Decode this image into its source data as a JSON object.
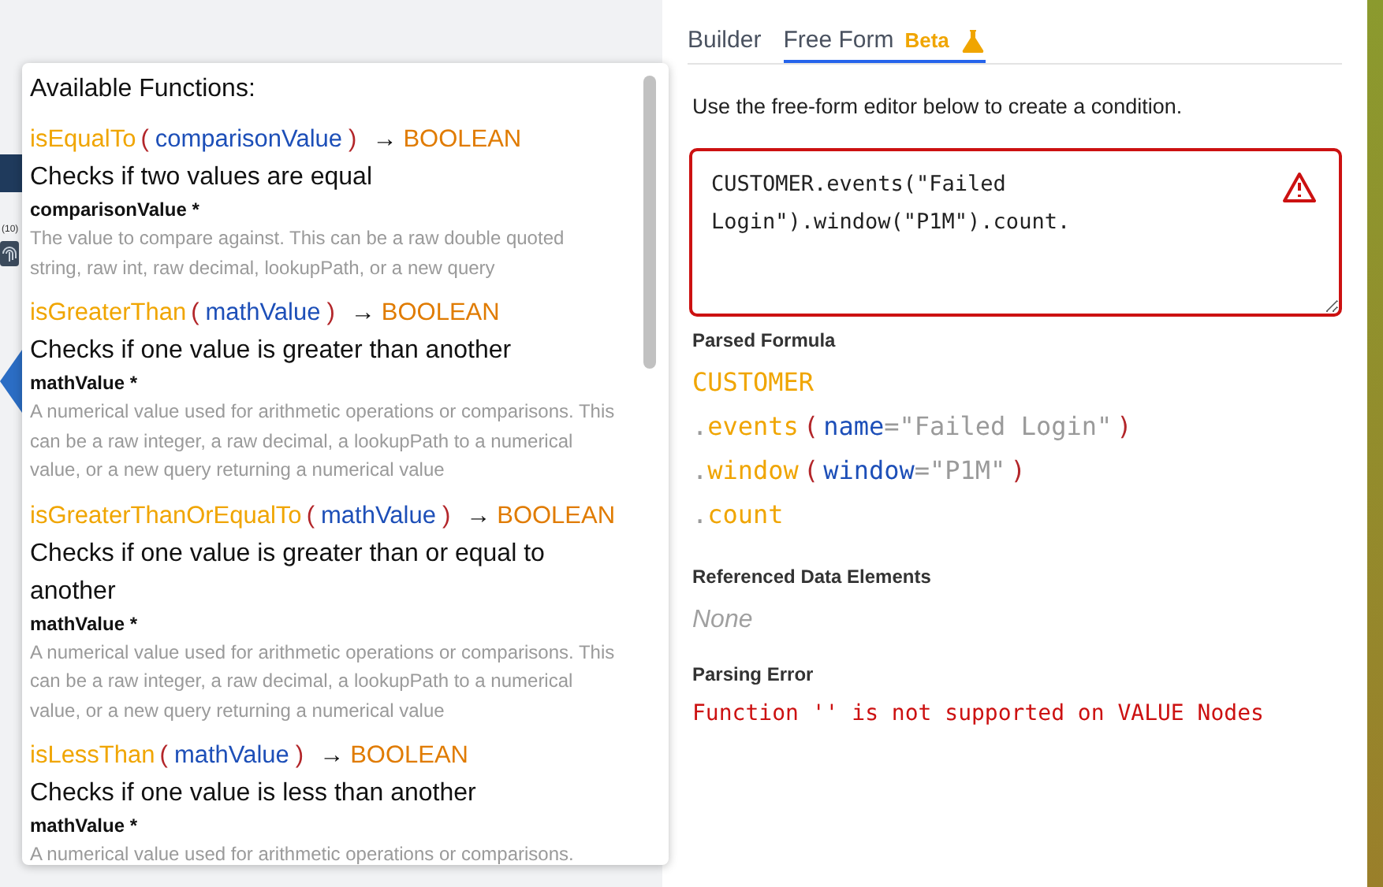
{
  "background": {
    "count_label": "(10)"
  },
  "tabs": [
    {
      "label": "Builder",
      "selected": false
    },
    {
      "label": "Free Form",
      "badge": "Beta",
      "selected": true
    }
  ],
  "functions_popup": {
    "title": "Available Functions:",
    "functions": [
      {
        "name": "isEqualTo",
        "open": "(",
        "param": "comparisonValue",
        "close": ")",
        "arrow": "→",
        "returns": "BOOLEAN",
        "description": "Checks if two values are equal",
        "param_label": "comparisonValue *",
        "param_description": "The value to compare against. This can be a raw double quoted string, raw int, raw decimal, lookupPath, or a new query"
      },
      {
        "name": "isGreaterThan",
        "open": "(",
        "param": "mathValue",
        "close": ")",
        "arrow": "→",
        "returns": "BOOLEAN",
        "description": "Checks if one value is greater than another",
        "param_label": "mathValue *",
        "param_description": "A numerical value used for arithmetic operations or comparisons. This can be a raw integer, a raw decimal, a lookupPath to a numerical value, or a new query returning a numerical value"
      },
      {
        "name": "isGreaterThanOrEqualTo",
        "open": "(",
        "param": "mathValue",
        "close": ")",
        "arrow": "→",
        "returns": "BOOLEAN",
        "description": "Checks if one value is greater than or equal to another",
        "param_label": "mathValue *",
        "param_description": "A numerical value used for arithmetic operations or comparisons. This can be a raw integer, a raw decimal, a lookupPath to a numerical value, or a new query returning a numerical value"
      },
      {
        "name": "isLessThan",
        "open": "(",
        "param": "mathValue",
        "close": ")",
        "arrow": "→",
        "returns": "BOOLEAN",
        "description": "Checks if one value is less than another",
        "param_label": "mathValue *",
        "param_description": "A numerical value used for arithmetic operations or comparisons."
      }
    ]
  },
  "hint": "Use the free-form editor below to create a condition.",
  "editor": {
    "value": "CUSTOMER.events(\"Failed Login\").window(\"P1M\").count.",
    "error": true
  },
  "parsed_formula": {
    "label": "Parsed Formula",
    "lines": [
      {
        "tokens": [
          {
            "kind": "root",
            "text": "CUSTOMER"
          }
        ]
      },
      {
        "tokens": [
          {
            "kind": "dot",
            "text": "."
          },
          {
            "kind": "method",
            "text": "events"
          },
          {
            "kind": "paren",
            "text": "("
          },
          {
            "kind": "arg",
            "text": "name"
          },
          {
            "kind": "eq",
            "text": "="
          },
          {
            "kind": "string",
            "text": "\"Failed Login\""
          },
          {
            "kind": "paren",
            "text": ")"
          }
        ]
      },
      {
        "tokens": [
          {
            "kind": "dot",
            "text": "."
          },
          {
            "kind": "method",
            "text": "window"
          },
          {
            "kind": "paren",
            "text": "("
          },
          {
            "kind": "arg",
            "text": "window"
          },
          {
            "kind": "eq",
            "text": "="
          },
          {
            "kind": "string",
            "text": "\"P1M\""
          },
          {
            "kind": "paren",
            "text": ")"
          }
        ]
      },
      {
        "tokens": [
          {
            "kind": "dot",
            "text": "."
          },
          {
            "kind": "method",
            "text": "count"
          }
        ]
      }
    ]
  },
  "referenced": {
    "label": "Referenced Data Elements",
    "value": "None"
  },
  "parsing_error": {
    "label": "Parsing Error",
    "message": "Function '' is not supported on VALUE Nodes"
  }
}
